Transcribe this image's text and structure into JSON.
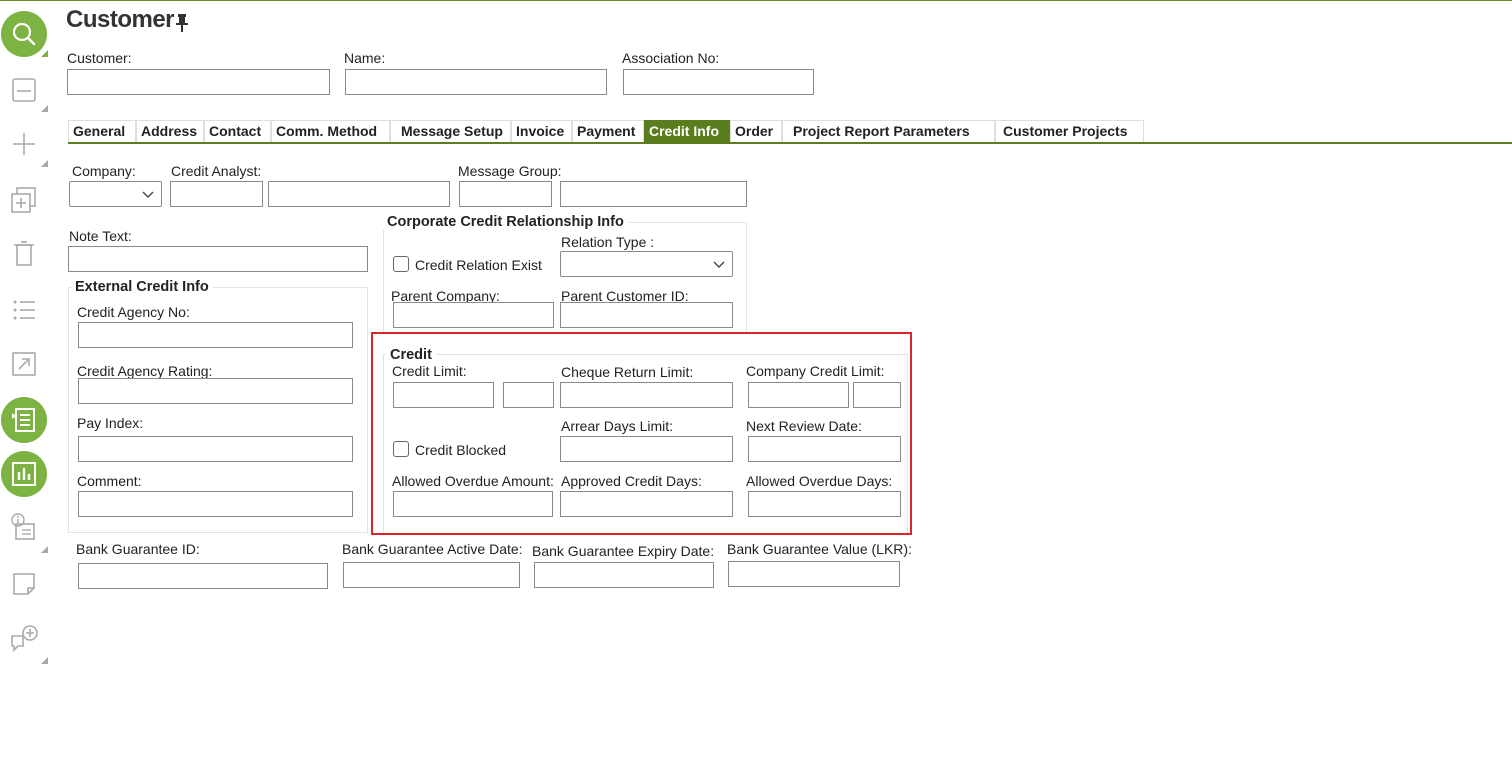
{
  "page": {
    "title": "Customer"
  },
  "sidebar": {
    "items": [
      "search-icon",
      "save-icon",
      "add-icon",
      "duplicate-icon",
      "delete-icon",
      "list-icon",
      "open-icon",
      "details-icon",
      "report-icon",
      "info-icon",
      "note-icon",
      "chat-icon"
    ]
  },
  "header": {
    "customer_label": "Customer:",
    "name_label": "Name:",
    "association_label": "Association No:"
  },
  "tabs": [
    {
      "label": "General"
    },
    {
      "label": "Address"
    },
    {
      "label": "Contact"
    },
    {
      "label": "Comm. Method"
    },
    {
      "label": "Message Setup"
    },
    {
      "label": "Invoice"
    },
    {
      "label": "Payment"
    },
    {
      "label": "Credit Info",
      "active": true
    },
    {
      "label": "Order"
    },
    {
      "label": "Project Report Parameters"
    },
    {
      "label": "Customer Projects"
    }
  ],
  "form": {
    "company_label": "Company:",
    "credit_analyst_label": "Credit Analyst:",
    "message_group_label": "Message Group:",
    "note_text_label": "Note Text:",
    "external": {
      "title": "External Credit Info",
      "agency_no_label": "Credit Agency No:",
      "agency_rating_label": "Credit Agency Rating:",
      "pay_index_label": "Pay Index:",
      "comment_label": "Comment:"
    },
    "corporate": {
      "title": "Corporate Credit Relationship Info",
      "relation_type_label": "Relation Type :",
      "credit_relation_exist_label": "Credit Relation Exist",
      "parent_company_label": "Parent Company:",
      "parent_customer_label": "Parent Customer ID:"
    },
    "credit": {
      "title": "Credit",
      "credit_limit_label": "Credit Limit:",
      "cheque_return_label": "Cheque Return Limit:",
      "company_credit_label": "Company Credit Limit:",
      "arrear_days_label": "Arrear Days Limit:",
      "next_review_label": "Next Review Date:",
      "credit_blocked_label": "Credit Blocked",
      "allowed_overdue_amount_label": "Allowed Overdue Amount:",
      "approved_credit_days_label": "Approved Credit Days:",
      "allowed_overdue_days_label": "Allowed Overdue Days:"
    },
    "bank": {
      "guarantee_id_label": "Bank Guarantee ID:",
      "active_date_label": "Bank Guarantee Active Date:",
      "expiry_date_label": "Bank Guarantee Expiry Date:",
      "value_label": "Bank Guarantee Value (LKR):"
    }
  },
  "colors": {
    "accent": "#7cb342",
    "tab_active": "#5a7d1e",
    "highlight": "#d9262b"
  }
}
